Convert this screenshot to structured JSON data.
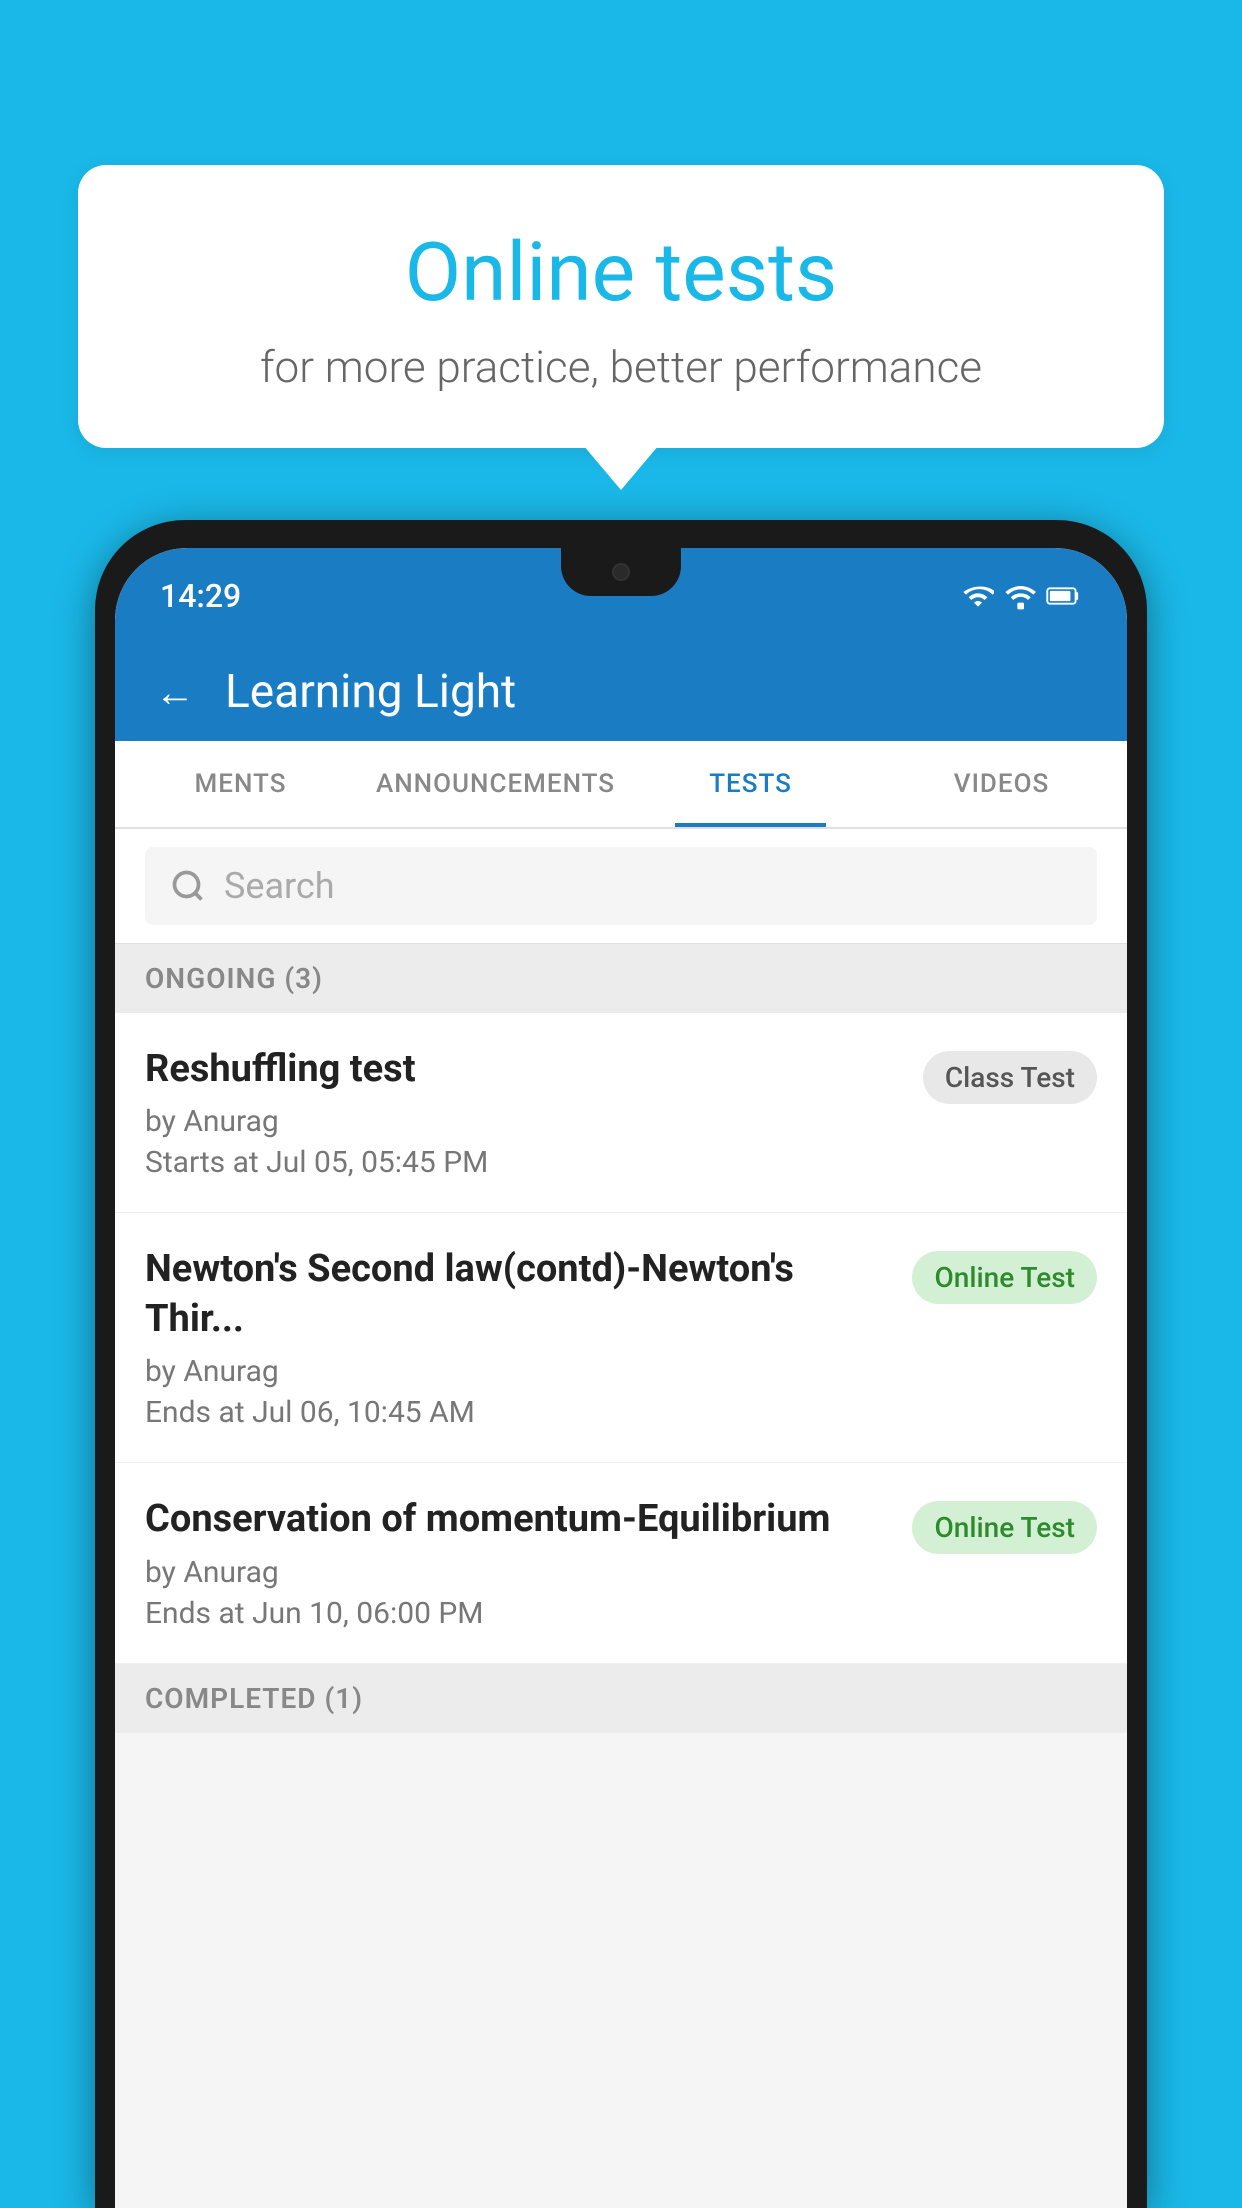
{
  "promo": {
    "title": "Online tests",
    "subtitle": "for more practice, better performance"
  },
  "phone": {
    "time": "14:29",
    "status_icons": [
      "wifi",
      "signal",
      "battery"
    ]
  },
  "app": {
    "back_label": "←",
    "title": "Learning Light",
    "tabs": [
      {
        "id": "ments",
        "label": "MENTS",
        "active": false
      },
      {
        "id": "announcements",
        "label": "ANNOUNCEMENTS",
        "active": false
      },
      {
        "id": "tests",
        "label": "TESTS",
        "active": true
      },
      {
        "id": "videos",
        "label": "VIDEOS",
        "active": false
      }
    ]
  },
  "search": {
    "placeholder": "Search"
  },
  "ongoing_section": {
    "title": "ONGOING (3)"
  },
  "tests": [
    {
      "name": "Reshuffling test",
      "author": "by Anurag",
      "time_label": "Starts at",
      "time_value": "Jul 05, 05:45 PM",
      "badge": "Class Test",
      "badge_type": "class"
    },
    {
      "name": "Newton's Second law(contd)-Newton's Thir...",
      "author": "by Anurag",
      "time_label": "Ends at",
      "time_value": "Jul 06, 10:45 AM",
      "badge": "Online Test",
      "badge_type": "online"
    },
    {
      "name": "Conservation of momentum-Equilibrium",
      "author": "by Anurag",
      "time_label": "Ends at",
      "time_value": "Jun 10, 06:00 PM",
      "badge": "Online Test",
      "badge_type": "online"
    }
  ],
  "completed_section": {
    "title": "COMPLETED (1)"
  }
}
